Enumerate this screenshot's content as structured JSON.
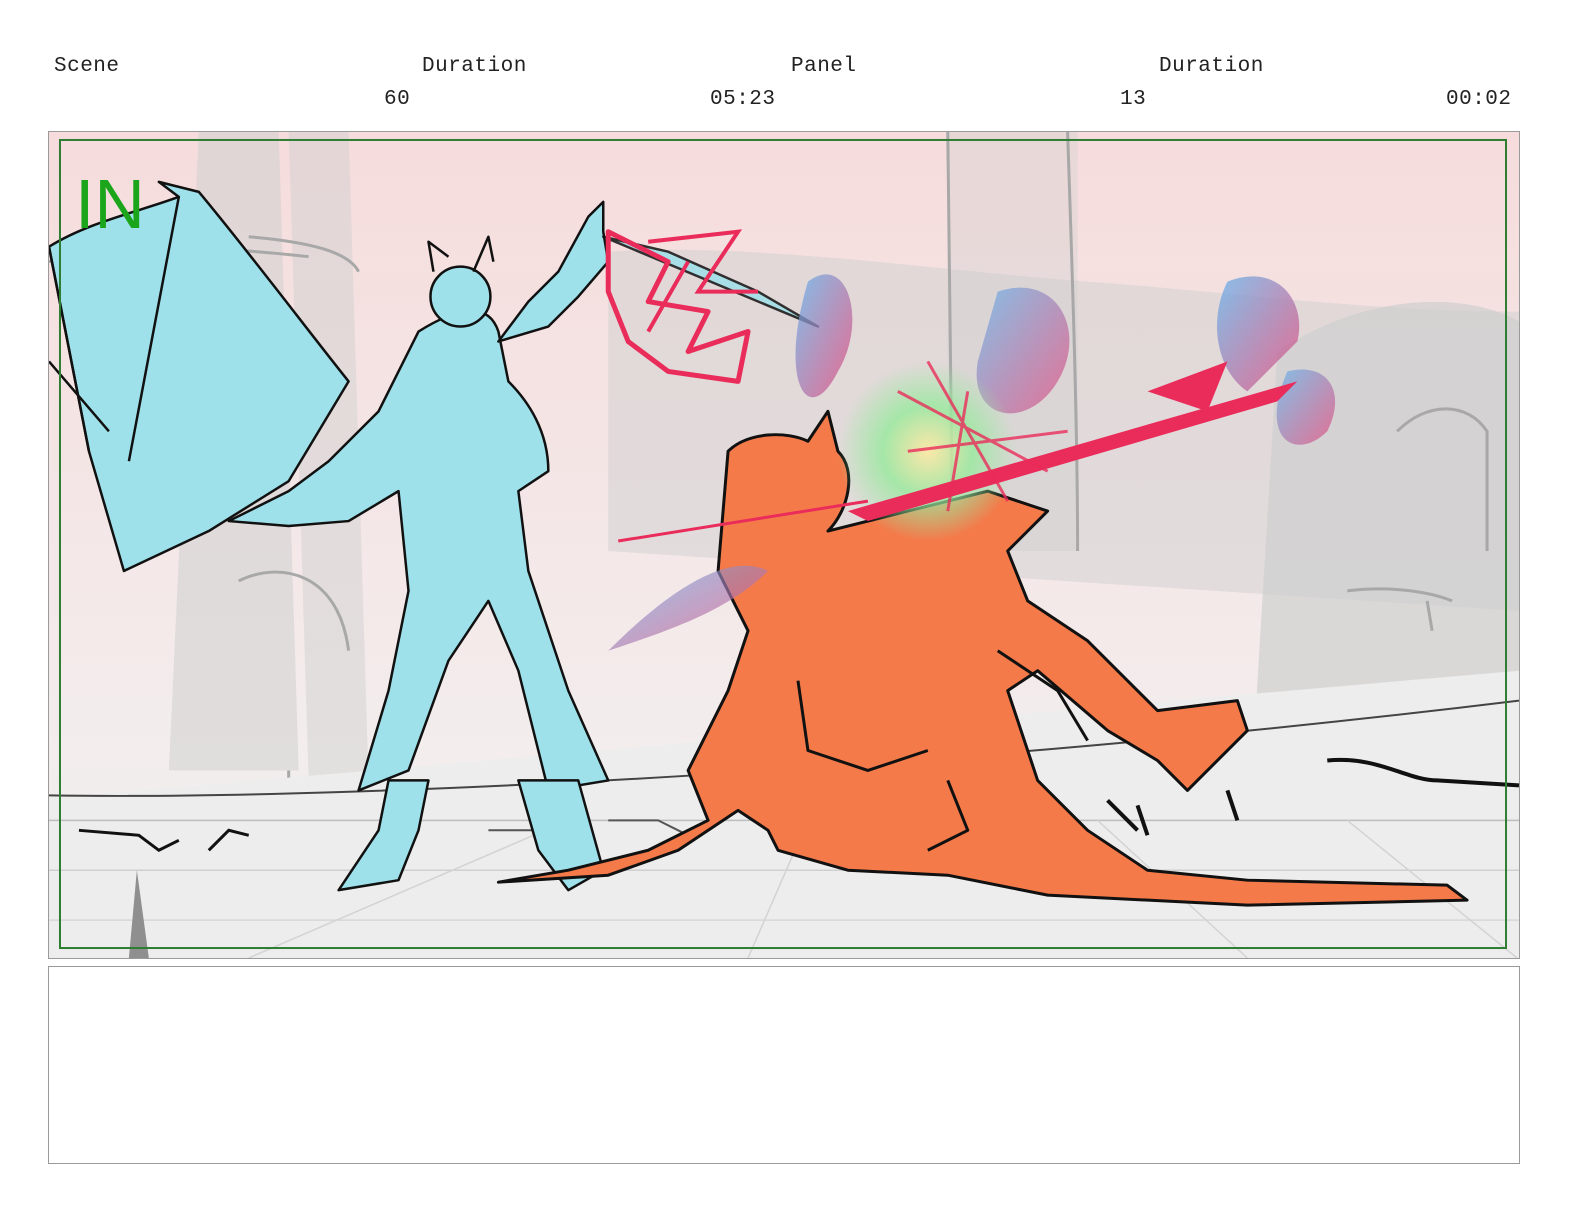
{
  "header": {
    "scene_label": "Scene",
    "scene_duration_label": "Duration",
    "panel_label": "Panel",
    "panel_duration_label": "Duration",
    "scene_value": "60",
    "scene_duration_value": "05:23",
    "panel_value": "13",
    "panel_duration_value": "00:02"
  },
  "panel": {
    "in_marker": "IN"
  },
  "colors": {
    "sky": "#f6dede",
    "safe_frame": "#2e7d32",
    "in_marker": "#1aa51a",
    "figure_left": "#9fe1ea",
    "figure_right": "#f47a4a",
    "slash_effect": "#ea2c5a"
  }
}
